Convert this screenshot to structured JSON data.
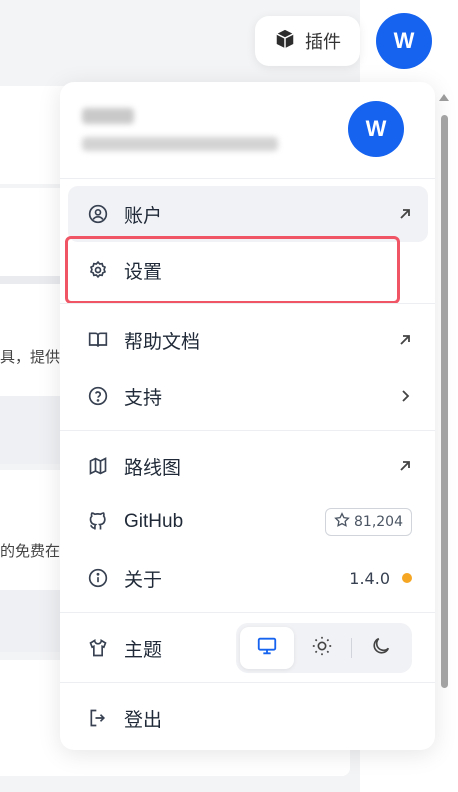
{
  "background": {
    "snippet_1": "具，提供",
    "snippet_2": "的免费在"
  },
  "topbar": {
    "plugin_label": "插件",
    "plugin_icon": "cube-icon",
    "avatar_letter": "W"
  },
  "menu": {
    "header": {
      "avatar_letter": "W"
    },
    "items": [
      {
        "id": "account",
        "label": "账户",
        "icon": "user-circle-icon",
        "trail": "external-arrow"
      },
      {
        "id": "settings",
        "label": "设置",
        "icon": "gear-icon",
        "trail": ""
      },
      {
        "id": "help-docs",
        "label": "帮助文档",
        "icon": "book-icon",
        "trail": "external-arrow"
      },
      {
        "id": "support",
        "label": "支持",
        "icon": "question-icon",
        "trail": "chevron-right"
      },
      {
        "id": "roadmap",
        "label": "路线图",
        "icon": "map-icon",
        "trail": "external-arrow"
      },
      {
        "id": "github",
        "label": "GitHub",
        "icon": "github-icon",
        "stars": "81,204"
      },
      {
        "id": "about",
        "label": "关于",
        "icon": "info-icon",
        "version": "1.4.0"
      },
      {
        "id": "theme",
        "label": "主题",
        "icon": "shirt-icon",
        "options": [
          "system",
          "light",
          "dark"
        ],
        "selected": "system"
      },
      {
        "id": "logout",
        "label": "登出",
        "icon": "logout-icon"
      }
    ]
  },
  "colors": {
    "accent": "#1663f0",
    "highlight": "#ef5565",
    "update_dot": "#f5a623"
  }
}
